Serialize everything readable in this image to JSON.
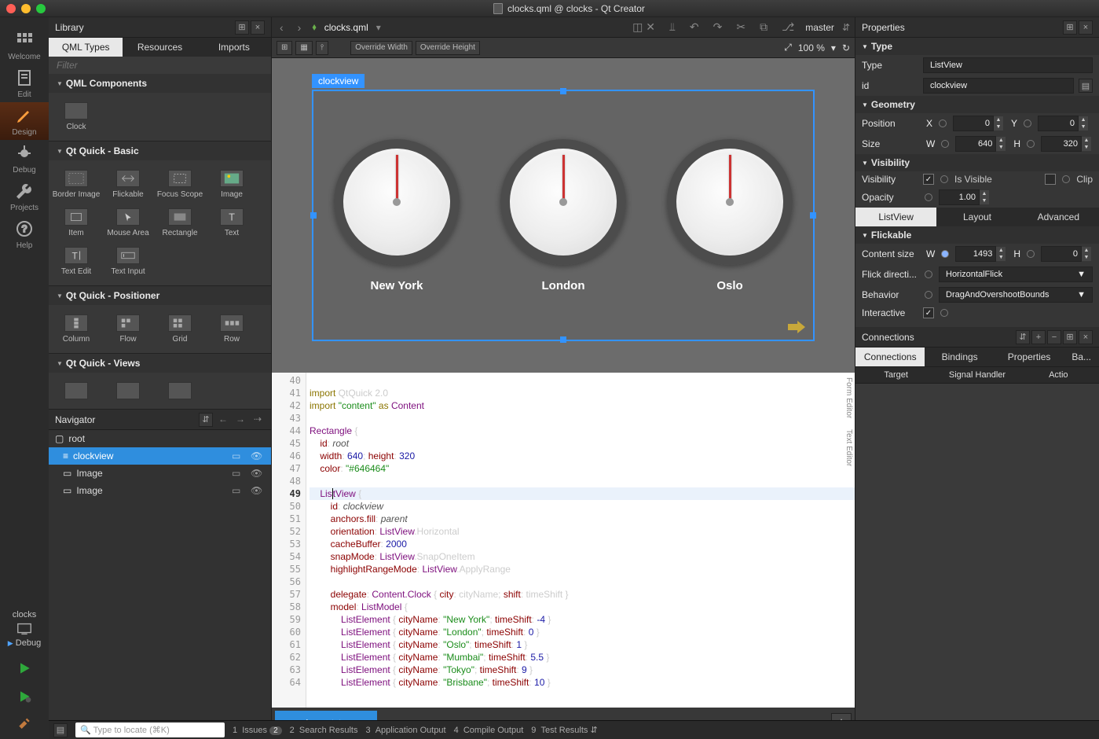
{
  "window": {
    "title": "clocks.qml @ clocks - Qt Creator"
  },
  "modebar": {
    "welcome": "Welcome",
    "edit": "Edit",
    "design": "Design",
    "debug": "Debug",
    "projects": "Projects",
    "help": "Help",
    "kit": "clocks",
    "build": "Debug"
  },
  "library": {
    "title": "Library",
    "tabs": {
      "qml": "QML Types",
      "resources": "Resources",
      "imports": "Imports"
    },
    "filter_ph": "Filter",
    "groups": {
      "components": {
        "title": "QML Components",
        "items": [
          {
            "name": "Clock"
          }
        ]
      },
      "basic": {
        "title": "Qt Quick - Basic",
        "items": [
          {
            "name": "Border Image"
          },
          {
            "name": "Flickable"
          },
          {
            "name": "Focus Scope"
          },
          {
            "name": "Image"
          },
          {
            "name": "Item"
          },
          {
            "name": "Mouse Area"
          },
          {
            "name": "Rectangle"
          },
          {
            "name": "Text"
          },
          {
            "name": "Text Edit"
          },
          {
            "name": "Text Input"
          }
        ]
      },
      "positioner": {
        "title": "Qt Quick - Positioner",
        "items": [
          {
            "name": "Column"
          },
          {
            "name": "Flow"
          },
          {
            "name": "Grid"
          },
          {
            "name": "Row"
          }
        ]
      },
      "views": {
        "title": "Qt Quick - Views"
      }
    }
  },
  "navigator": {
    "title": "Navigator",
    "nodes": {
      "root": "root",
      "clockview": "clockview",
      "image1": "Image",
      "image2": "Image"
    }
  },
  "crumb": {
    "file": "clocks.qml",
    "master": "master"
  },
  "toolbar": {
    "override_w": "Override Width",
    "override_h": "Override Height",
    "zoom": "100 %"
  },
  "canvas": {
    "tag": "clockview",
    "cities": [
      "New York",
      "London",
      "Oslo"
    ]
  },
  "code": {
    "lines": [
      40,
      41,
      42,
      43,
      44,
      45,
      46,
      47,
      48,
      49,
      50,
      51,
      52,
      53,
      54,
      55,
      56,
      57,
      58,
      59,
      60,
      61,
      62,
      63,
      64
    ]
  },
  "state": {
    "base": "base state"
  },
  "side_tabs": {
    "form": "Form Editor",
    "text": "Text Editor"
  },
  "properties": {
    "title": "Properties",
    "type_section": "Type",
    "type_label": "Type",
    "type_value": "ListView",
    "id_label": "id",
    "id_value": "clockview",
    "geometry": "Geometry",
    "position": "Position",
    "x_label": "X",
    "x_value": "0",
    "y_label": "Y",
    "y_value": "0",
    "size": "Size",
    "w_label": "W",
    "w_value": "640",
    "h_label": "H",
    "h_value": "320",
    "visibility_section": "Visibility",
    "visibility": "Visibility",
    "is_visible": "Is Visible",
    "clip": "Clip",
    "opacity": "Opacity",
    "opacity_value": "1.00",
    "tabs": {
      "listview": "ListView",
      "layout": "Layout",
      "advanced": "Advanced"
    },
    "flickable": "Flickable",
    "content_size": "Content size",
    "content_w": "1493",
    "content_h": "0",
    "flick_dir": "Flick directi...",
    "flick_val": "HorizontalFlick",
    "behavior": "Behavior",
    "behavior_val": "DragAndOvershootBounds",
    "interactive": "Interactive"
  },
  "connections": {
    "title": "Connections",
    "tabs": {
      "conn": "Connections",
      "bind": "Bindings",
      "props": "Properties",
      "back": "Ba..."
    },
    "cols": {
      "target": "Target",
      "signal": "Signal Handler",
      "action": "Actio"
    }
  },
  "locator": {
    "placeholder": "Type to locate (⌘K)",
    "issues": "Issues",
    "issues_count": "2",
    "search": "Search Results",
    "appout": "Application Output",
    "compile": "Compile Output",
    "test": "Test Results"
  }
}
